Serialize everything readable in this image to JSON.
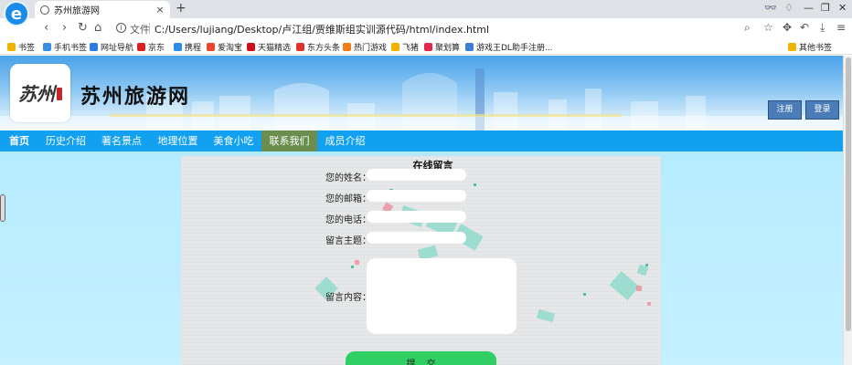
{
  "browser": {
    "logo_letter": "e",
    "tab_title": "苏州旅游网",
    "tab_close": "×",
    "new_tab": "+",
    "address_label": "文件",
    "url": "C:/Users/lujiang/Desktop/卢江组/贾维斯组实训源代码/html/index.html",
    "bookmarks": [
      {
        "label": "书签",
        "color": "#f0b400"
      },
      {
        "label": "手机书签",
        "color": "#3a8ee6"
      },
      {
        "label": "网址导航",
        "color": "#2b7de0"
      },
      {
        "label": "京东",
        "color": "#d91f1f"
      },
      {
        "label": "携程",
        "color": "#2b8be6"
      },
      {
        "label": "爱淘宝",
        "color": "#e8452c"
      },
      {
        "label": "天猫精选",
        "color": "#d00f1c"
      },
      {
        "label": "东方头条",
        "color": "#e0322a"
      },
      {
        "label": "热门游戏",
        "color": "#f07b1a"
      },
      {
        "label": "飞猪",
        "color": "#f5b000"
      },
      {
        "label": "聚划算",
        "color": "#e6274d"
      },
      {
        "label": "游戏王DL助手注册...",
        "color": "#3b7fd8"
      }
    ],
    "other_bookmarks": "其他书签"
  },
  "site": {
    "logo_text": "苏州",
    "title": "苏州旅游网",
    "register": "注册",
    "login": "登录",
    "nav": [
      "首页",
      "历史介绍",
      "著名景点",
      "地理位置",
      "美食小吃",
      "联系我们",
      "成员介绍"
    ],
    "active_nav": "联系我们"
  },
  "form": {
    "title": "在线留言",
    "labels": {
      "name": "您的姓名：",
      "email": "您的邮箱：",
      "phone": "您的电话：",
      "subject": "留言主题：",
      "content": "留言内容："
    },
    "submit": "提交"
  },
  "colors": {
    "navbar": "#12a0f0",
    "nav_active": "#6b8e4e",
    "submit": "#2fcf63"
  }
}
